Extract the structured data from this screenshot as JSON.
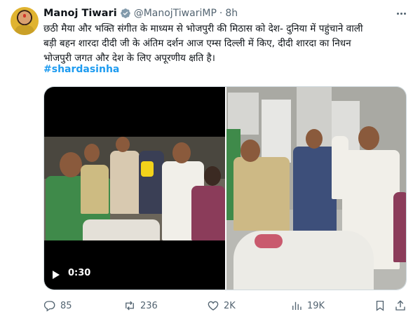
{
  "author": {
    "name": "Manoj Tiwari",
    "handle": "@ManojTiwariMP",
    "separator": "·",
    "time": "8h"
  },
  "tweet": {
    "lines": [
      "छठी मैया और भक्ति संगीत के माध्यम से भोजपुरी की मिठास को देश- दुनिया में पहुंचाने वाली",
      "बड़ी बहन शारदा दीदी जी के अंतिम दर्शन आज एम्स दिल्ली में किए, दीदी शारदा का निधन",
      "भोजपुरी जगत और देश के लिए अपूरणीय क्षति है।"
    ],
    "hashtag": "#shardasinha"
  },
  "media": {
    "video_duration": "0:30"
  },
  "actions": {
    "replies": "85",
    "reposts": "236",
    "likes": "2K",
    "views": "19K"
  },
  "colors": {
    "accent": "#1d9bf0",
    "secondary_text": "#536471"
  },
  "icons": [
    "verified-badge-icon",
    "more-icon",
    "play-icon",
    "reply-icon",
    "repost-icon",
    "like-icon",
    "views-icon",
    "bookmark-icon",
    "share-icon"
  ]
}
